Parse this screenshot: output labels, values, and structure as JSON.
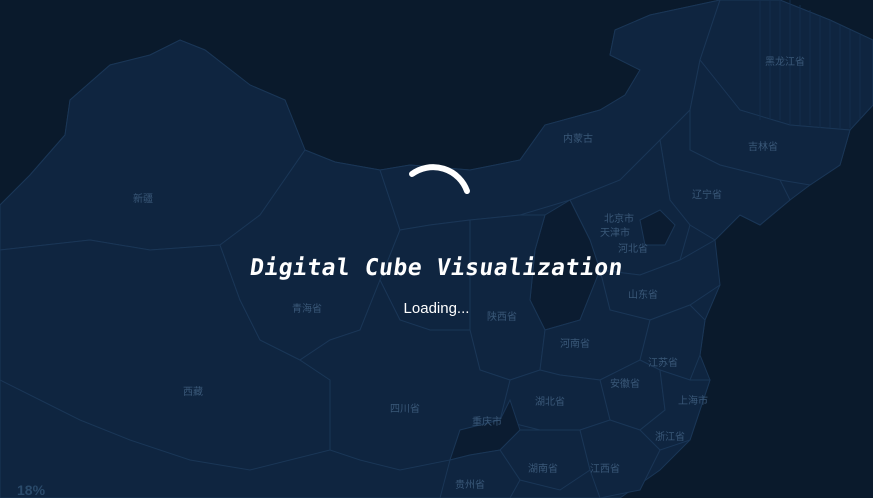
{
  "title": "Digital Cube Visualization",
  "loading_text": "Loading...",
  "progress_text": "18%",
  "map_labels": {
    "heilongjiang": "黑龙江省",
    "jilin": "吉林省",
    "neimenggu": "内蒙古",
    "liaoning": "辽宁省",
    "xinjiang": "新疆",
    "beijing": "北京市",
    "tianjin": "天津市",
    "hebei": "河北省",
    "shandong": "山东省",
    "qinghai": "青海省",
    "shaanxi": "陕西省",
    "henan": "河南省",
    "jiangsu": "江苏省",
    "anhui": "安徽省",
    "xizang": "西藏",
    "sichuan": "四川省",
    "hubei": "湖北省",
    "shanghai": "上海市",
    "chongqing": "重庆市",
    "zhejiang": "浙江省",
    "hunan": "湖南省",
    "jiangxi": "江西省",
    "guizhou": "贵州省"
  },
  "colors": {
    "background": "#0a1a2c",
    "province_fill": "#0f2540",
    "province_border": "#1a3656",
    "label": "#3a5878",
    "spinner": "#ffffff"
  },
  "icons": {
    "spinner": "loading-spinner-icon"
  }
}
